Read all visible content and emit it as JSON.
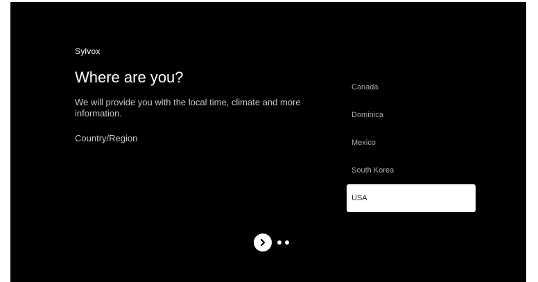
{
  "brand": "Sylvox",
  "title": "Where are you?",
  "description": "We will provide you with the local time, climate and more information.",
  "region_label": "Country/Region",
  "countries": [
    {
      "label": "Canada",
      "selected": false
    },
    {
      "label": "Dominica",
      "selected": false
    },
    {
      "label": "Mexico",
      "selected": false
    },
    {
      "label": "South Korea",
      "selected": false
    },
    {
      "label": "USA",
      "selected": true
    }
  ],
  "nav": {
    "next_icon": "chevron-right-icon",
    "page_count": 2,
    "current_page": 1
  },
  "colors": {
    "background": "#000000",
    "text": "#ffffff",
    "muted_text": "#a8a8a8",
    "selected_bg": "#ffffff"
  }
}
